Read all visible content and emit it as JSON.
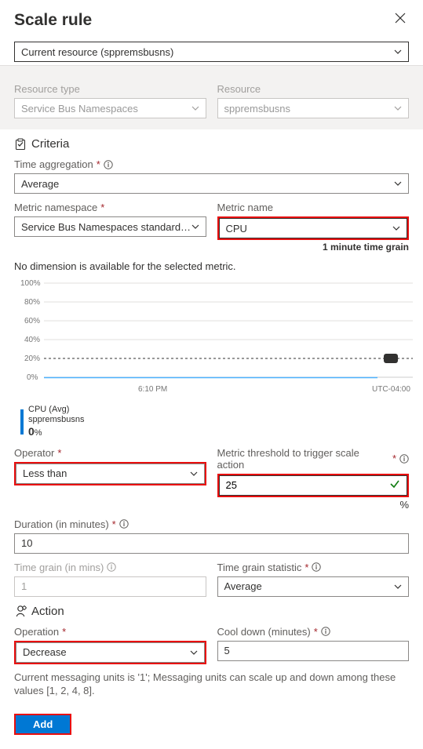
{
  "header": {
    "title": "Scale rule"
  },
  "scope": {
    "value": "Current resource (sppremsbusns)"
  },
  "resource_type": {
    "label": "Resource type",
    "value": "Service Bus Namespaces"
  },
  "resource": {
    "label": "Resource",
    "value": "sppremsbusns"
  },
  "criteria_title": "Criteria",
  "time_aggregation": {
    "label": "Time aggregation",
    "value": "Average"
  },
  "metric_namespace": {
    "label": "Metric namespace",
    "value": "Service Bus Namespaces standard me..."
  },
  "metric_name": {
    "label": "Metric name",
    "value": "CPU",
    "grain": "1 minute time grain"
  },
  "no_dimension": "No dimension is available for the selected metric.",
  "chart_data": {
    "type": "line",
    "y_ticks": [
      "100%",
      "80%",
      "60%",
      "40%",
      "20%",
      "0%"
    ],
    "ylim": [
      0,
      100
    ],
    "threshold": 25,
    "x_tick_label": "6:10 PM",
    "timezone": "UTC-04:00",
    "series": [
      {
        "name": "CPU (Avg)",
        "resource": "sppremsbusns",
        "value": "0",
        "unit": "%"
      }
    ]
  },
  "operator": {
    "label": "Operator",
    "value": "Less than"
  },
  "threshold": {
    "label": "Metric threshold to trigger scale action",
    "value": "25",
    "unit": "%"
  },
  "duration": {
    "label": "Duration (in minutes)",
    "value": "10"
  },
  "time_grain": {
    "label": "Time grain (in mins)",
    "value": "1"
  },
  "time_grain_stat": {
    "label": "Time grain statistic",
    "value": "Average"
  },
  "action_title": "Action",
  "operation": {
    "label": "Operation",
    "value": "Decrease"
  },
  "cooldown": {
    "label": "Cool down (minutes)",
    "value": "5"
  },
  "footnote": "Current messaging units is '1'; Messaging units can scale up and down among these values [1, 2, 4, 8].",
  "add_button": "Add"
}
